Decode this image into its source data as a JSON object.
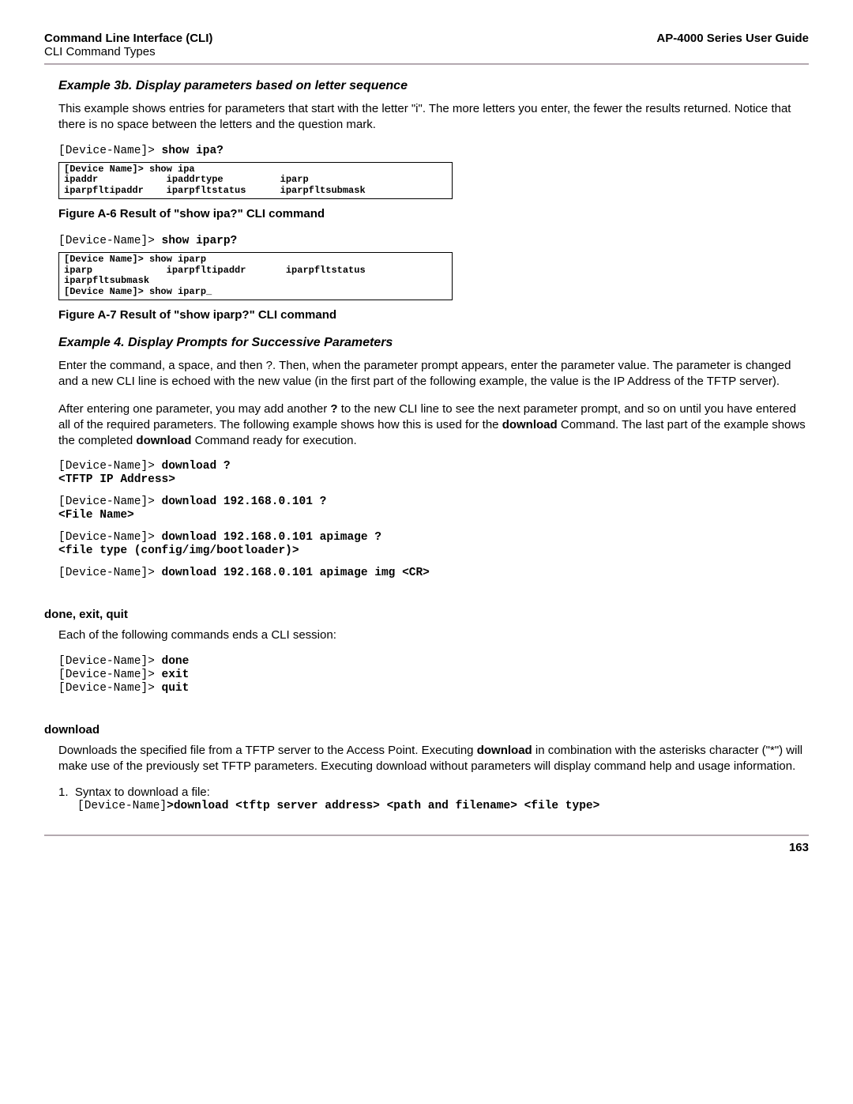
{
  "header": {
    "left_title": "Command Line Interface (CLI)",
    "left_sub": "CLI Command Types",
    "right_title": "AP-4000 Series User Guide"
  },
  "ex3b": {
    "title": "Example 3b. Display parameters based on letter sequence",
    "para": "This example shows entries for parameters that start with the letter \"i\". The more letters you enter, the fewer the results returned. Notice that there is no space between the letters and the question mark.",
    "cli1_prompt": "[Device-Name]>",
    "cli1_cmd": "show ipa?",
    "box1_l1": "[Device Name]> show ipa",
    "box1_l2": "ipaddr            ipaddrtype          iparp",
    "box1_l3": "iparpfltipaddr    iparpfltstatus      iparpfltsubmask",
    "fig1": "Figure A-6 Result of \"show ipa?\" CLI command",
    "cli2_prompt": "[Device-Name]>",
    "cli2_cmd": "show iparp?",
    "box2_l1": "[Device Name]> show iparp",
    "box2_l2": "iparp             iparpfltipaddr       iparpfltstatus",
    "box2_l3": "iparpfltsubmask",
    "box2_l4": "[Device Name]> show iparp_",
    "fig2": "Figure A-7 Result of \"show iparp?\" CLI command"
  },
  "ex4": {
    "title": "Example 4. Display Prompts for Successive Parameters",
    "para1": "Enter the command, a space, and then ?. Then, when the parameter prompt appears, enter the parameter value. The parameter is changed and a new CLI line is echoed with the new value (in the first part of the following example, the value is the IP Address of the TFTP server).",
    "para2_a": "After entering one parameter, you may add another ",
    "para2_b": "?",
    "para2_c": " to the new CLI line to see the next parameter prompt, and so on until you have entered all of the required parameters. The following example shows how this is used for the ",
    "para2_d": "download",
    "para2_e": " Command. The last part of the example shows the completed ",
    "para2_f": "download",
    "para2_g": " Command ready for execution.",
    "l1_prompt": "[Device-Name]>",
    "l1_cmd": "download ?",
    "l2_out": "<TFTP IP Address>",
    "l3_prompt": "[Device-Name]>",
    "l3_cmd": "download 192.168.0.101 ?",
    "l4_out": "<File Name>",
    "l5_prompt": "[Device-Name]>",
    "l5_cmd": "download 192.168.0.101 apimage ?",
    "l6_out": "<file type (config/img/bootloader)>",
    "l7_prompt": "[Device-Name]>",
    "l7_cmd": "download 192.168.0.101 apimage img <CR>"
  },
  "done": {
    "heading": "done, exit, quit",
    "intro": "Each of the following commands ends a CLI session:",
    "l1_p": "[Device-Name]>",
    "l1_c": "done",
    "l2_p": "[Device-Name]>",
    "l2_c": "exit",
    "l3_p": "[Device-Name]>",
    "l3_c": "quit"
  },
  "download": {
    "heading": "download",
    "para_a": "Downloads the specified file from a TFTP server to the Access Point. Executing ",
    "para_b": "download",
    "para_c": " in combination with the asterisks character (\"*\") will make use of the previously set TFTP parameters. Executing download without parameters will display command help and usage information.",
    "item1_text": "Syntax to download a file:",
    "item1_prompt": "[Device-Name]",
    "item1_cmd": ">download <tftp server address> <path and filename> <file type>"
  },
  "page": "163"
}
